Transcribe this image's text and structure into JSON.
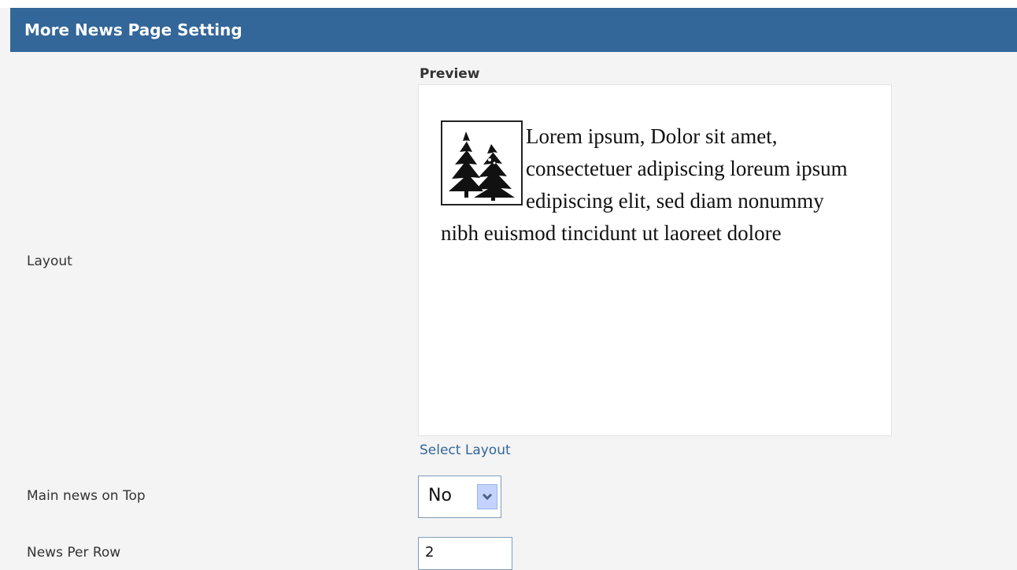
{
  "header": {
    "title": "More News Page Setting"
  },
  "form": {
    "layout_label": "Layout",
    "preview_label": "Preview",
    "preview_text": "Lorem ipsum, Dolor sit amet, consectetuer adipiscing loreum ipsum edipiscing elit, sed diam nonummy nibh euismod tincidunt ut laoreet dolore",
    "select_layout_link": "Select Layout",
    "main_news_label": "Main news on Top",
    "main_news_value": "No",
    "news_per_row_label": "News Per Row",
    "news_per_row_value": "2"
  },
  "icons": {
    "preview_image": "pine-trees-icon",
    "dropdown": "chevron-down-icon"
  }
}
